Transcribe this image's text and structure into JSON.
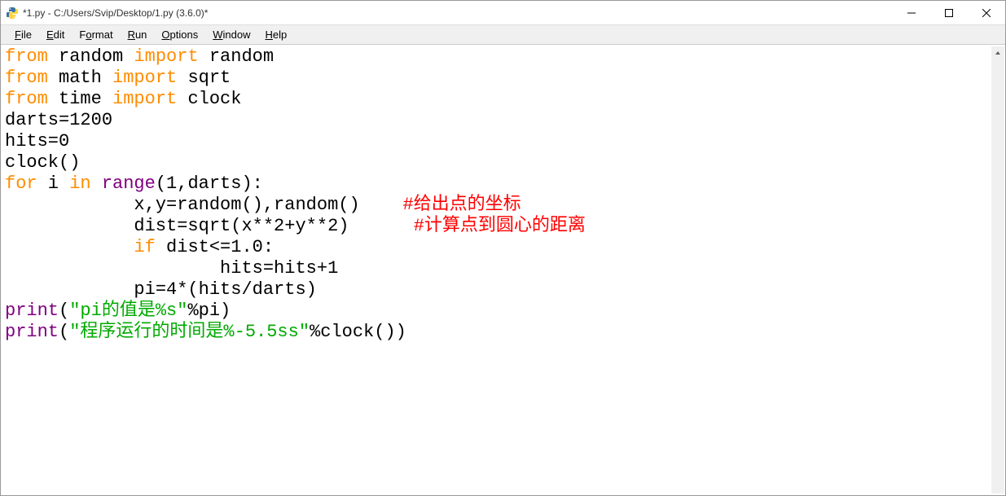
{
  "window": {
    "title": "*1.py - C:/Users/Svip/Desktop/1.py (3.6.0)*"
  },
  "menu": {
    "file": "File",
    "edit": "Edit",
    "format": "Format",
    "run": "Run",
    "options": "Options",
    "window": "Window",
    "help": "Help"
  },
  "code": {
    "l1a": "from",
    "l1b": " random ",
    "l1c": "import",
    "l1d": " random",
    "l2a": "from",
    "l2b": " math ",
    "l2c": "import",
    "l2d": " sqrt",
    "l3a": "from",
    "l3b": " time ",
    "l3c": "import",
    "l3d": " clock",
    "l4": "darts=1200",
    "l5": "hits=0",
    "l6": "clock()",
    "l7a": "for",
    "l7b": " i ",
    "l7c": "in",
    "l7d": " ",
    "l7e": "range",
    "l7f": "(1,darts):",
    "l8a": "            x,y=random(),random()    ",
    "l8b": "#给出点的坐标",
    "l9a": "            dist=sqrt(x**2+y**2)      ",
    "l9b": "#计算点到圆心的距离",
    "l10a": "            ",
    "l10b": "if",
    "l10c": " dist<=1.0:",
    "l11": "                    hits=hits+1",
    "l12": "            pi=4*(hits/darts)",
    "l13a": "print",
    "l13b": "(",
    "l13c": "\"pi的值是%s\"",
    "l13d": "%pi)",
    "l14a": "print",
    "l14b": "(",
    "l14c": "\"程序运行的时间是%-5.5ss\"",
    "l14d": "%clock())"
  }
}
